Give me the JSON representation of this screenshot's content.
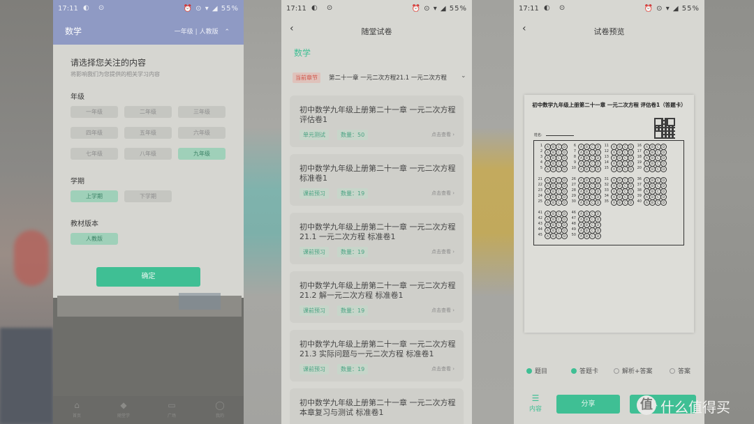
{
  "status_bar": {
    "time": "17:11",
    "battery": "55%"
  },
  "screen1": {
    "header_subject": "数学",
    "header_grade": "一年级",
    "header_edition": "人教版",
    "sheet_title": "请选择您关注的内容",
    "sheet_subtitle": "将影响我们为您提供的相关学习内容",
    "grade_label": "年级",
    "grades": [
      "一年级",
      "二年级",
      "三年级",
      "四年级",
      "五年级",
      "六年级",
      "七年级",
      "八年级",
      "九年级"
    ],
    "selected_grade": "九年级",
    "term_label": "学期",
    "terms": [
      "上学期",
      "下学期"
    ],
    "selected_term": "上学期",
    "edition_label": "教材版本",
    "editions": [
      "人教版"
    ],
    "confirm": "确定",
    "nav": [
      "首页",
      "随堂学",
      "广场",
      "我的"
    ]
  },
  "screen2": {
    "title": "随堂试卷",
    "subject": "数学",
    "chapter_badge": "当前章节",
    "chapter": "第二十一章 一元二次方程21.1 一元二次方程",
    "view_label": "点击查看",
    "papers": [
      {
        "title": "初中数学九年级上册第二十一章 一元二次方程 评估卷1",
        "tag": "单元测试",
        "count": "数量：50"
      },
      {
        "title": "初中数学九年级上册第二十一章 一元二次方程 标准卷1",
        "tag": "课前预习",
        "count": "数量：19"
      },
      {
        "title": "初中数学九年级上册第二十一章 一元二次方程 21.1 一元二次方程 标准卷1",
        "tag": "课前预习",
        "count": "数量：19"
      },
      {
        "title": "初中数学九年级上册第二十一章 一元二次方程 21.2 解一元二次方程 标准卷1",
        "tag": "课前预习",
        "count": "数量：19"
      },
      {
        "title": "初中数学九年级上册第二十一章 一元二次方程 21.3 实际问题与一元二次方程 标准卷1",
        "tag": "课前预习",
        "count": "数量：19"
      },
      {
        "title": "初中数学九年级上册第二十一章 一元二次方程 本章复习与测试 标准卷1"
      }
    ]
  },
  "screen3": {
    "title": "试卷预览",
    "sheet_title": "初中数学九年级上册第二十一章 一元二次方程 评估卷1（答题卡）",
    "name_label": "姓名:",
    "choices": [
      "A",
      "B",
      "C",
      "D"
    ],
    "options": [
      {
        "label": "题目",
        "checked": true
      },
      {
        "label": "答题卡",
        "checked": true
      },
      {
        "label": "解析+答案",
        "checked": false
      },
      {
        "label": "答案",
        "checked": false
      }
    ],
    "contents_label": "内容",
    "share": "分享",
    "partial_button": "八",
    "accent": "#3fbf94"
  },
  "watermark": "什么值得买"
}
